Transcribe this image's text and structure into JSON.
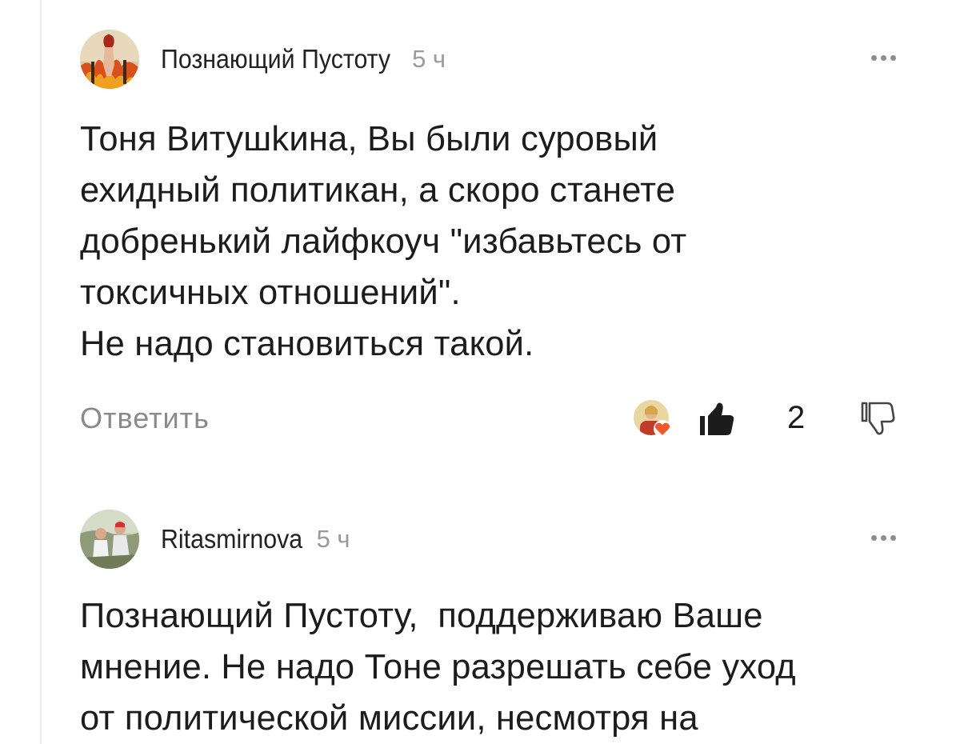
{
  "comments": [
    {
      "author": "Познающий Пустоту",
      "time": "5 ч",
      "text": "Тоня Витушkина, Вы были суровый\nехидный политикан, а скоро станете\nдобренький лайфкоуч \"избавьтесь от\nтоксичных отношений\".\nНе надо становиться такой.",
      "reply_label": "Ответить",
      "likes": "2",
      "avatar_icon": "avatar-figure-fire",
      "reactor_icon": "heart-reaction-icon"
    },
    {
      "author": "Ritasmirnova",
      "time": "5 ч",
      "text": "Познающий Пустоту,  поддерживаю Ваше\nмнение. Не надо Тоне разрешать себе уход\nот политической миссии, несмотря на",
      "avatar_icon": "avatar-photo-people"
    }
  ],
  "icons": {
    "more": "more-dots-icon",
    "like": "thumbs-up-icon",
    "dislike": "thumbs-down-icon"
  },
  "colors": {
    "text": "#1c1c1c",
    "muted": "#8a8a8a",
    "heart": "#f05a2a"
  }
}
